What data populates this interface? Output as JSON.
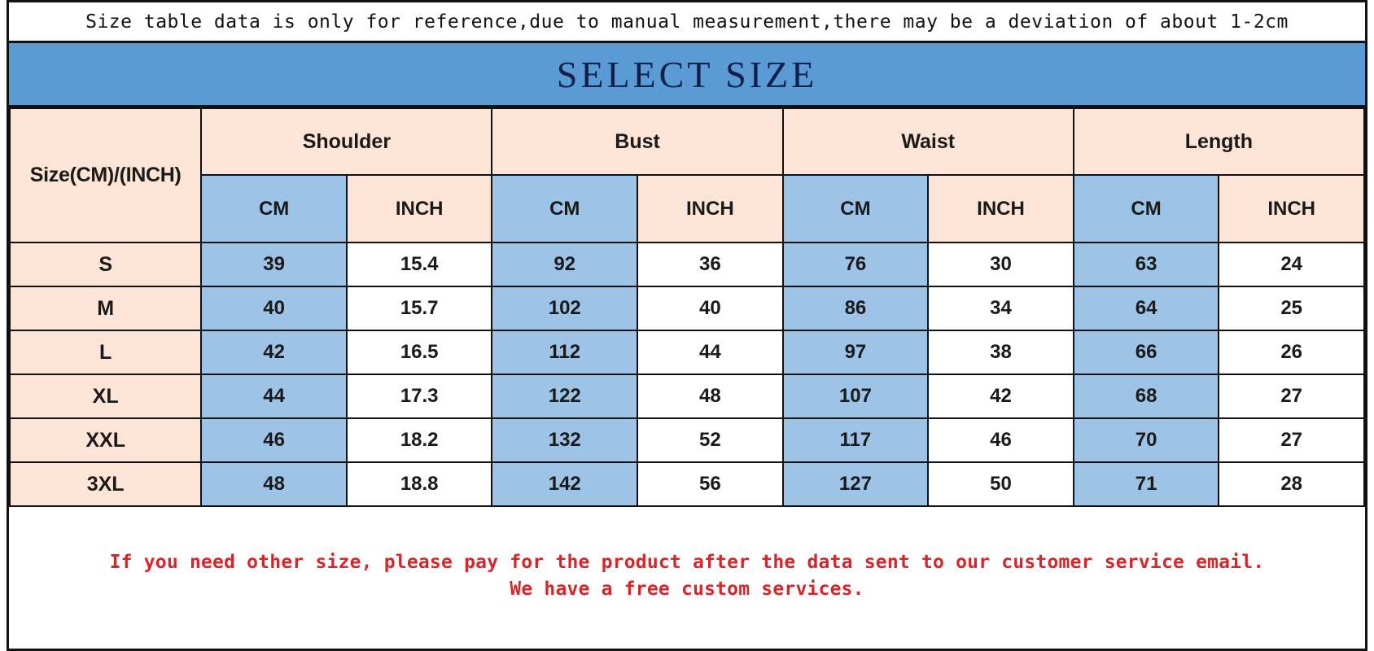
{
  "note": {
    "text": "Size table data is only for reference,due to manual measurement,there may be a deviation of about 1-2cm"
  },
  "title": {
    "text": "SELECT SIZE"
  },
  "table": {
    "size_header": "Size(CM)/(INCH)",
    "groups": [
      {
        "label": "Shoulder",
        "units": [
          "CM",
          "INCH"
        ]
      },
      {
        "label": "Bust",
        "units": [
          "CM",
          "INCH"
        ]
      },
      {
        "label": "Waist",
        "units": [
          "CM",
          "INCH"
        ]
      },
      {
        "label": "Length",
        "units": [
          "CM",
          "INCH"
        ]
      }
    ],
    "unit_cm": "CM",
    "unit_inch": "INCH",
    "rows": [
      {
        "size": "S",
        "shoulder_cm": "39",
        "shoulder_inch": "15.4",
        "bust_cm": "92",
        "bust_inch": "36",
        "waist_cm": "76",
        "waist_inch": "30",
        "length_cm": "63",
        "length_inch": "24"
      },
      {
        "size": "M",
        "shoulder_cm": "40",
        "shoulder_inch": "15.7",
        "bust_cm": "102",
        "bust_inch": "40",
        "waist_cm": "86",
        "waist_inch": "34",
        "length_cm": "64",
        "length_inch": "25"
      },
      {
        "size": "L",
        "shoulder_cm": "42",
        "shoulder_inch": "16.5",
        "bust_cm": "112",
        "bust_inch": "44",
        "waist_cm": "97",
        "waist_inch": "38",
        "length_cm": "66",
        "length_inch": "26"
      },
      {
        "size": "XL",
        "shoulder_cm": "44",
        "shoulder_inch": "17.3",
        "bust_cm": "122",
        "bust_inch": "48",
        "waist_cm": "107",
        "waist_inch": "42",
        "length_cm": "68",
        "length_inch": "27"
      },
      {
        "size": "XXL",
        "shoulder_cm": "46",
        "shoulder_inch": "18.2",
        "bust_cm": "132",
        "bust_inch": "52",
        "waist_cm": "117",
        "waist_inch": "46",
        "length_cm": "70",
        "length_inch": "27"
      },
      {
        "size": "3XL",
        "shoulder_cm": "48",
        "shoulder_inch": "18.8",
        "bust_cm": "142",
        "bust_inch": "56",
        "waist_cm": "127",
        "waist_inch": "50",
        "length_cm": "71",
        "length_inch": "28"
      }
    ]
  },
  "footer": {
    "line1": "If you need other size, please pay for the product after the data sent to our customer service email.",
    "line2": "We have a free custom services."
  },
  "colors": {
    "title_band": "#5b9bd5",
    "title_text": "#11204a",
    "peach": "#fce4d6",
    "blue_cell": "#9dc3e6",
    "white_cell": "#ffffff",
    "border": "#111111",
    "footer_text": "#d7262a"
  }
}
